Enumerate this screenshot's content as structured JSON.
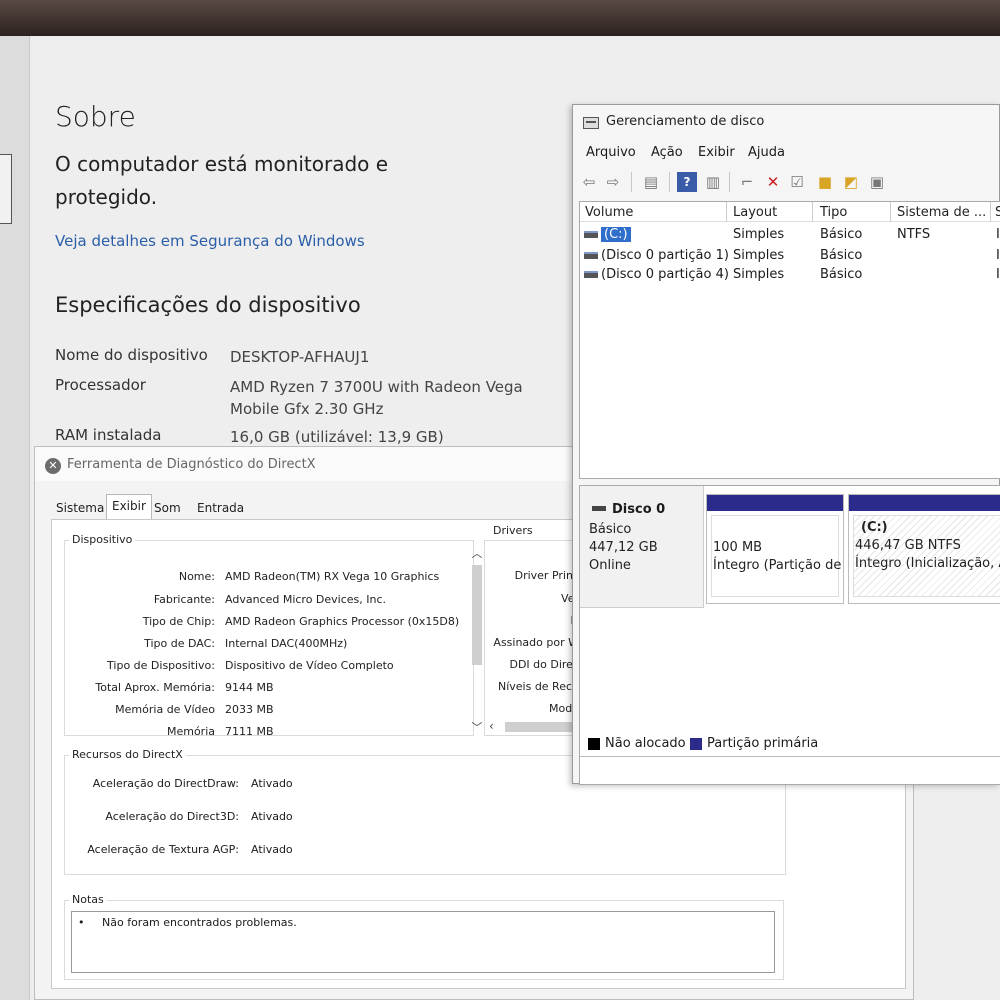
{
  "settings": {
    "title": "Sobre",
    "protected_text": "O computador está monitorado e protegido.",
    "security_link": "Veja detalhes em Segurança do Windows",
    "specs_title": "Especificações do dispositivo",
    "specs": [
      {
        "key": "Nome do dispositivo",
        "value": "DESKTOP-AFHAUJ1"
      },
      {
        "key": "Processador",
        "value": "AMD Ryzen 7 3700U with Radeon Vega Mobile Gfx     2.30 GHz"
      },
      {
        "key": "RAM instalada",
        "value": "16,0 GB (utilizável: 13,9 GB)"
      }
    ]
  },
  "directx": {
    "title": "Ferramenta de Diagnóstico do DirectX",
    "tabs": [
      "Sistema",
      "Exibir",
      "Som",
      "Entrada"
    ],
    "active_tab": "Exibir",
    "device_group": "Dispositivo",
    "device": [
      {
        "key": "Nome:",
        "value": "AMD Radeon(TM) RX Vega 10 Graphics"
      },
      {
        "key": "Fabricante:",
        "value": "Advanced Micro Devices, Inc."
      },
      {
        "key": "Tipo de Chip:",
        "value": "AMD Radeon Graphics Processor (0x15D8)"
      },
      {
        "key": "Tipo de DAC:",
        "value": "Internal DAC(400MHz)"
      },
      {
        "key": "Tipo de Dispositivo:",
        "value": "Dispositivo de Vídeo Completo"
      },
      {
        "key": "Total Aprox. Memória:",
        "value": "9144 MB"
      },
      {
        "key": "Memória de Vídeo",
        "value": "2033 MB"
      },
      {
        "key": "Memória",
        "value": "7111 MB"
      }
    ],
    "drivers_group": "Drivers",
    "drivers": [
      "Driver Princ",
      "Ver",
      "D",
      "Assinado por W",
      "DDI do Direc",
      "Níveis de Recu",
      "Mode"
    ],
    "resources_group": "Recursos do DirectX",
    "resources": [
      {
        "key": "Aceleração do DirectDraw:",
        "value": "Ativado"
      },
      {
        "key": "Aceleração do Direct3D:",
        "value": "Ativado"
      },
      {
        "key": "Aceleração de Textura AGP:",
        "value": "Ativado"
      }
    ],
    "notes_group": "Notas",
    "notes": "Não foram encontrados problemas.",
    "notes_bullet": "•"
  },
  "disk_mgmt": {
    "title": "Gerenciamento de disco",
    "menu": [
      "Arquivo",
      "Ação",
      "Exibir",
      "Ajuda"
    ],
    "columns": [
      "Volume",
      "Layout",
      "Tipo",
      "Sistema de ...",
      "S"
    ],
    "volumes": [
      {
        "volume": "(C:)",
        "layout": "Simples",
        "type": "Básico",
        "fs": "NTFS",
        "s": "I"
      },
      {
        "volume": "(Disco 0 partição 1)",
        "layout": "Simples",
        "type": "Básico",
        "fs": "",
        "s": "I"
      },
      {
        "volume": "(Disco 0 partição 4)",
        "layout": "Simples",
        "type": "Básico",
        "fs": "",
        "s": "I"
      }
    ],
    "disk": {
      "name": "Disco 0",
      "type": "Básico",
      "size": "447,12 GB",
      "status": "Online"
    },
    "partitions": [
      {
        "label": "",
        "size": "100 MB",
        "status": "Íntegro (Partição de"
      },
      {
        "label": "(C:)",
        "size": "446,47 GB NTFS",
        "status": "Íntegro (Inicialização, Ar"
      }
    ],
    "legend": [
      {
        "label": "Não alocado",
        "color": "#000000"
      },
      {
        "label": "Partição primária",
        "color": "#2b2b8c"
      }
    ]
  }
}
